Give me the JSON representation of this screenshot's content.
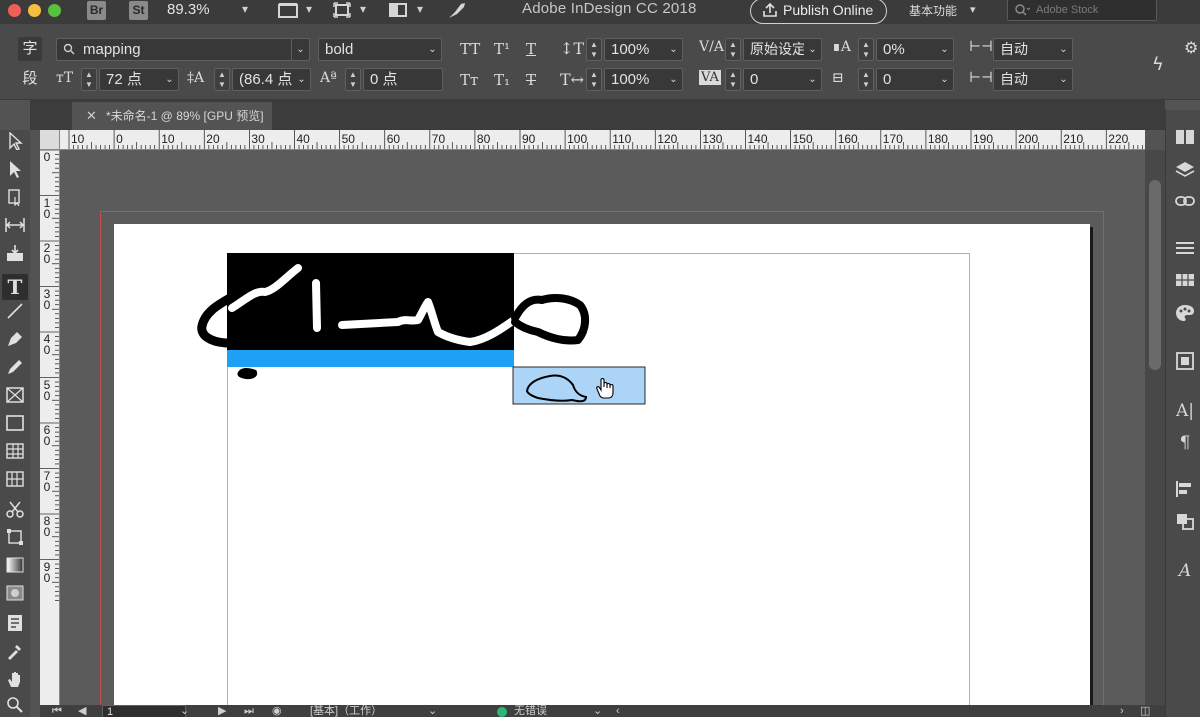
{
  "titlebar": {
    "bridge_badge": "Br",
    "stock_badge": "St",
    "zoom": "89.3%",
    "app_title": "Adobe InDesign CC 2018",
    "publish_label": "Publish Online",
    "workspace_label": "基本功能",
    "stock_search_placeholder": "Adobe Stock"
  },
  "controlbar": {
    "char_mode": "字",
    "para_mode": "段",
    "font_family": "mapping",
    "font_style": "bold",
    "font_size": "72 点",
    "leading": "(86.4 点",
    "kerning_method": "原始设定",
    "tracking_value": "0",
    "vertical_scale": "100%",
    "horizontal_scale": "100%",
    "baseline_shift": "0 点",
    "skew_value": "0",
    "tsume_value": "0%",
    "grid_value": "0",
    "auto_1": "自动",
    "auto_2": "自动"
  },
  "document": {
    "tab_title": "*未命名-1 @ 89% [GPU 预览]"
  },
  "rulers": {
    "h_labels": [
      "10",
      "0",
      "10",
      "20",
      "30",
      "40",
      "50",
      "60",
      "70",
      "80",
      "90",
      "100",
      "110",
      "120",
      "130",
      "140",
      "150",
      "160",
      "170",
      "180",
      "190",
      "200",
      "210",
      "220"
    ],
    "v_labels": [
      "0",
      "10",
      "20",
      "30",
      "40",
      "50",
      "60",
      "70",
      "80",
      "90"
    ]
  },
  "statusbar": {
    "page_number": "1",
    "profile": "[基本]（工作）",
    "preflight": "无错误"
  },
  "colors": {
    "selection_blue": "#1ea0f5",
    "thread_highlight": "#acd4f7",
    "bleed_red": "#c0504d",
    "preflight_green": "#2bb673"
  }
}
